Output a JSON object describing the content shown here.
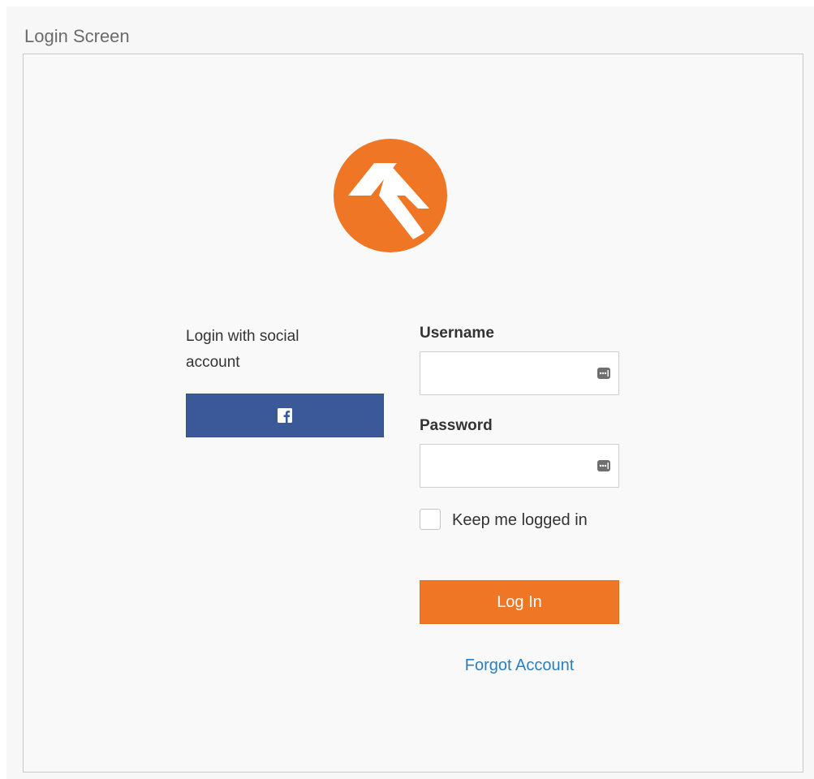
{
  "screen": {
    "title": "Login Screen"
  },
  "brand": {
    "logo_icon": "rock-rms-logo-icon",
    "accent_color": "#ee7624"
  },
  "social": {
    "label": "Login with social account",
    "facebook_icon": "facebook-icon",
    "facebook_color": "#3b5998"
  },
  "form": {
    "username_label": "Username",
    "username_value": "",
    "password_label": "Password",
    "password_value": "",
    "password_manager_icon": "password-manager-icon",
    "remember_label": "Keep me logged in",
    "remember_checked": false,
    "login_label": "Log In",
    "forgot_label": "Forgot Account"
  },
  "colors": {
    "link": "#2a7fc0",
    "text": "#333333",
    "title": "#6b6b6b"
  }
}
